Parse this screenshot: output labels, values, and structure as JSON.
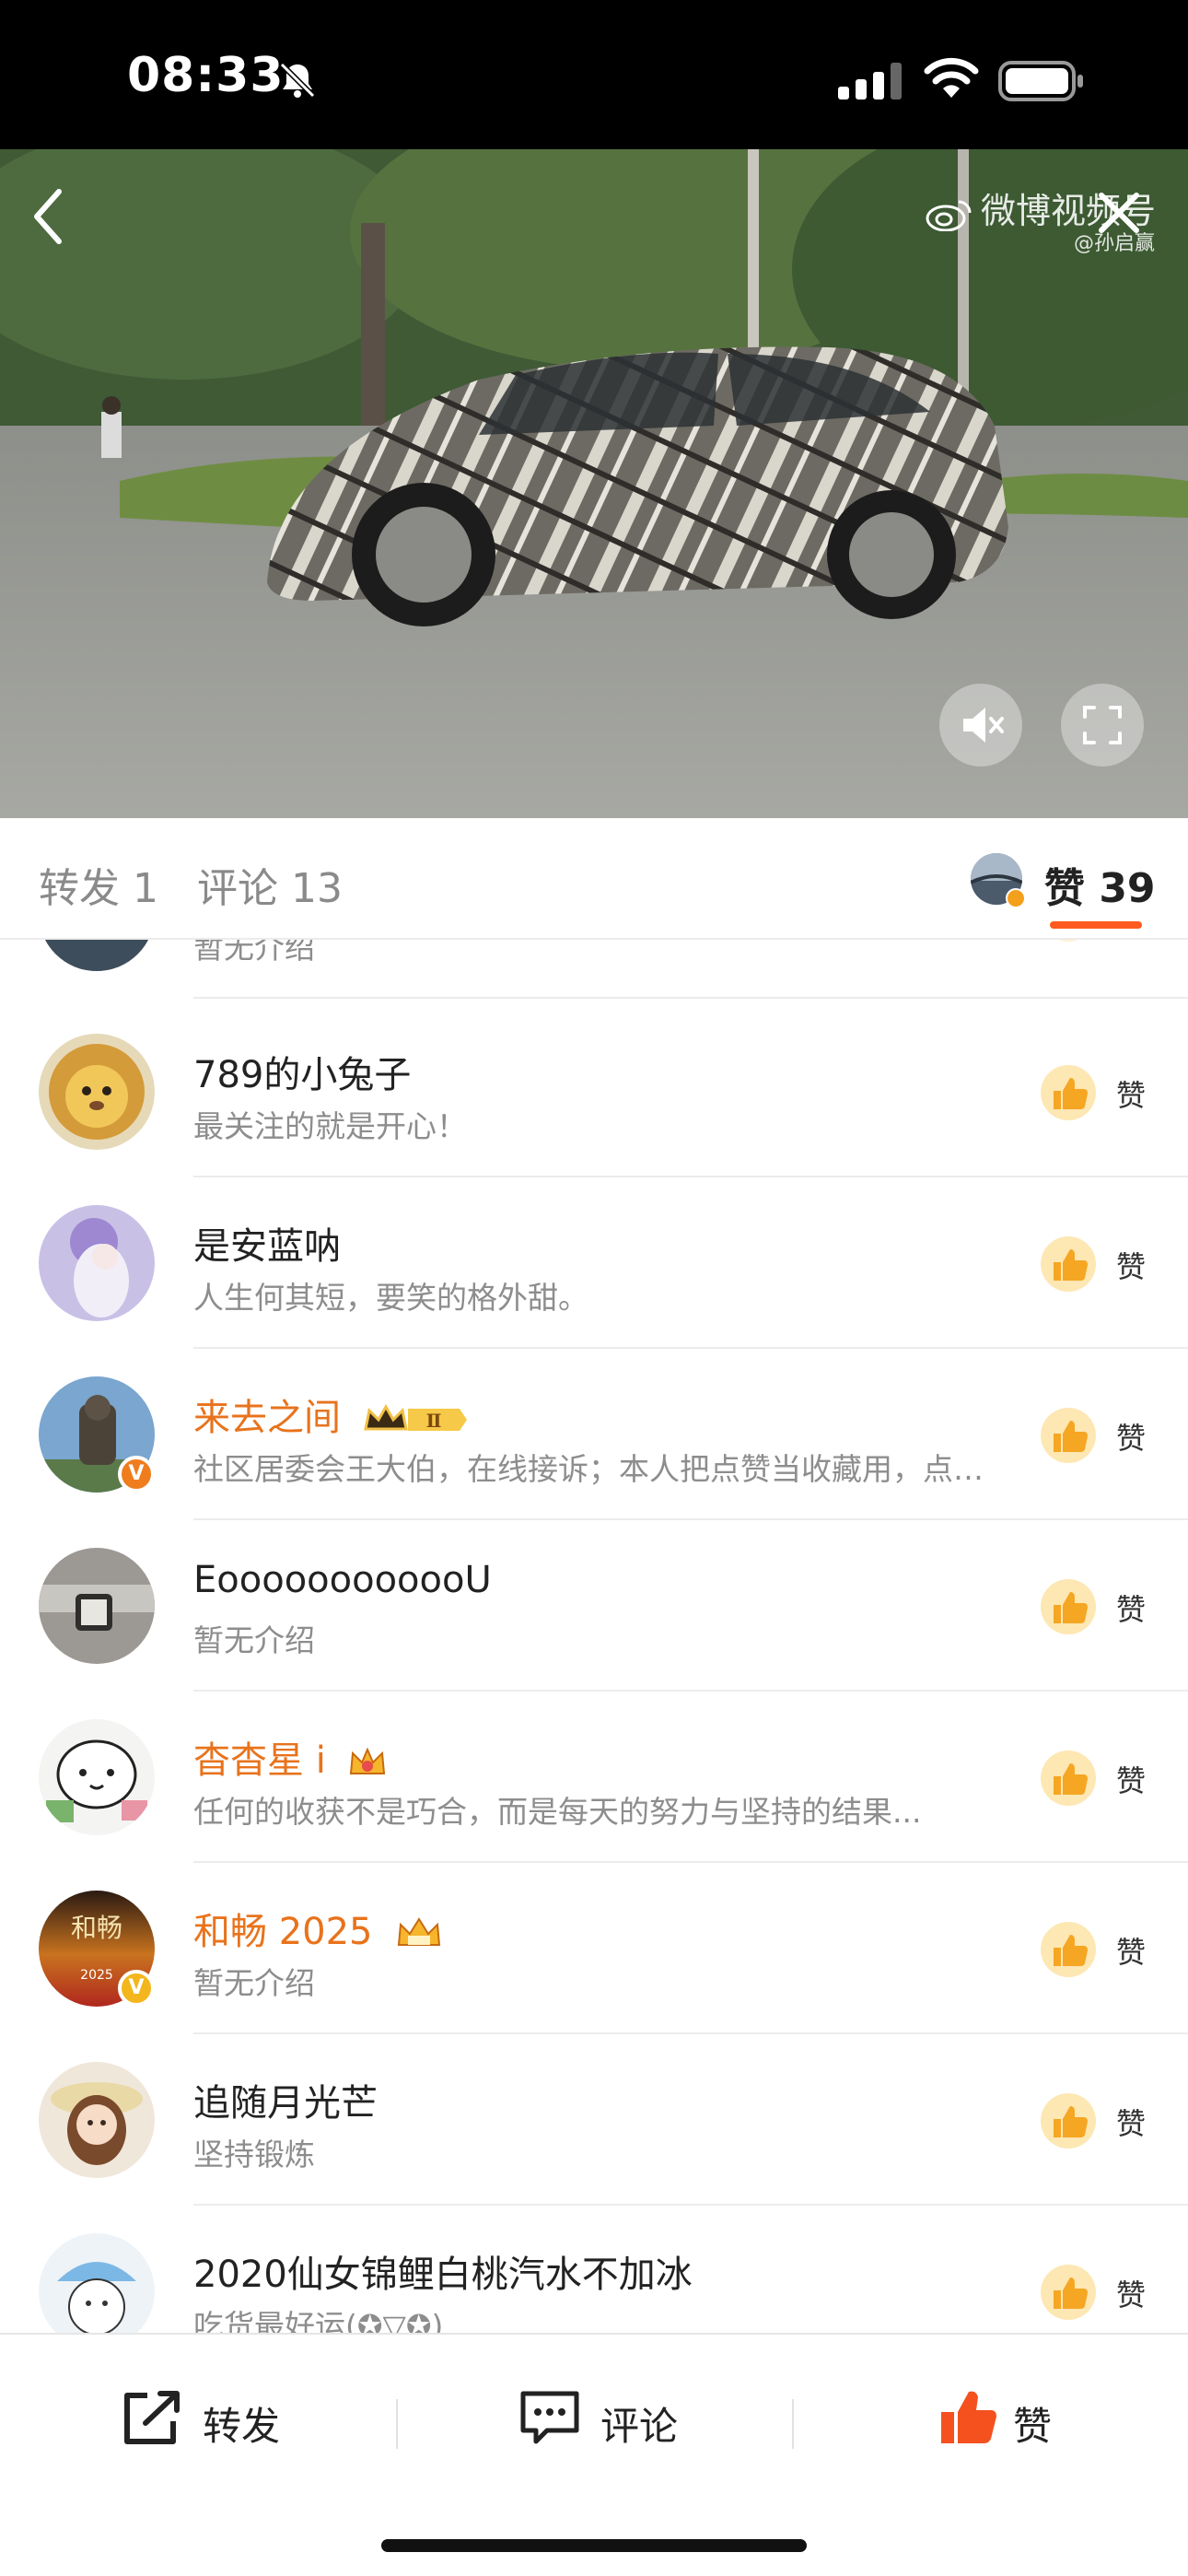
{
  "status_bar": {
    "time": "08:33",
    "icons": [
      "bell-slash-icon",
      "signal-icon",
      "wifi-icon",
      "battery-icon"
    ]
  },
  "video": {
    "watermark": "微博视频号",
    "watermark_handle": "@孙启赢",
    "controls": [
      "back-icon",
      "close-icon",
      "mute-icon",
      "fullscreen-icon"
    ]
  },
  "tabs": {
    "repost": "转发 1",
    "comment": "评论 13",
    "like": "赞 39",
    "accent_color": "#ff5a1f"
  },
  "like_label": "赞",
  "likers": [
    {
      "name": "",
      "bio": "暂无介绍",
      "vip": false
    },
    {
      "name": "789的小兔子",
      "bio": "最关注的就是开心！",
      "vip": false
    },
    {
      "name": "是安蓝呐",
      "bio": "人生何其短，要笑的格外甜。",
      "vip": false
    },
    {
      "name": "来去之间",
      "bio": "社区居委会王大伯，在线接诉；本人把点赞当收藏用，点赞不代表赞同...",
      "vip": true,
      "badge": "Ⅱ",
      "verified": "orange"
    },
    {
      "name": "EoooooooooooU",
      "bio": "暂无介绍",
      "vip": false
    },
    {
      "name": "杳杳星 i",
      "bio": "任何的收获不是巧合，而是每天的努力与坚持的结果...",
      "vip": true
    },
    {
      "name": "和畅 2025",
      "bio": "暂无介绍",
      "vip": true,
      "verified": "yellow",
      "avatar_text": "和畅",
      "avatar_subtext": "2025"
    },
    {
      "name": "追随月光芒",
      "bio": "坚持锻炼",
      "vip": false
    },
    {
      "name": "2020仙女锦鲤白桃汽水不加冰",
      "bio": "吃货最好运(✪▽✪)",
      "vip": false
    }
  ],
  "action_bar": {
    "repost": "转发",
    "comment": "评论",
    "like": "赞",
    "like_color": "#f4511e"
  }
}
